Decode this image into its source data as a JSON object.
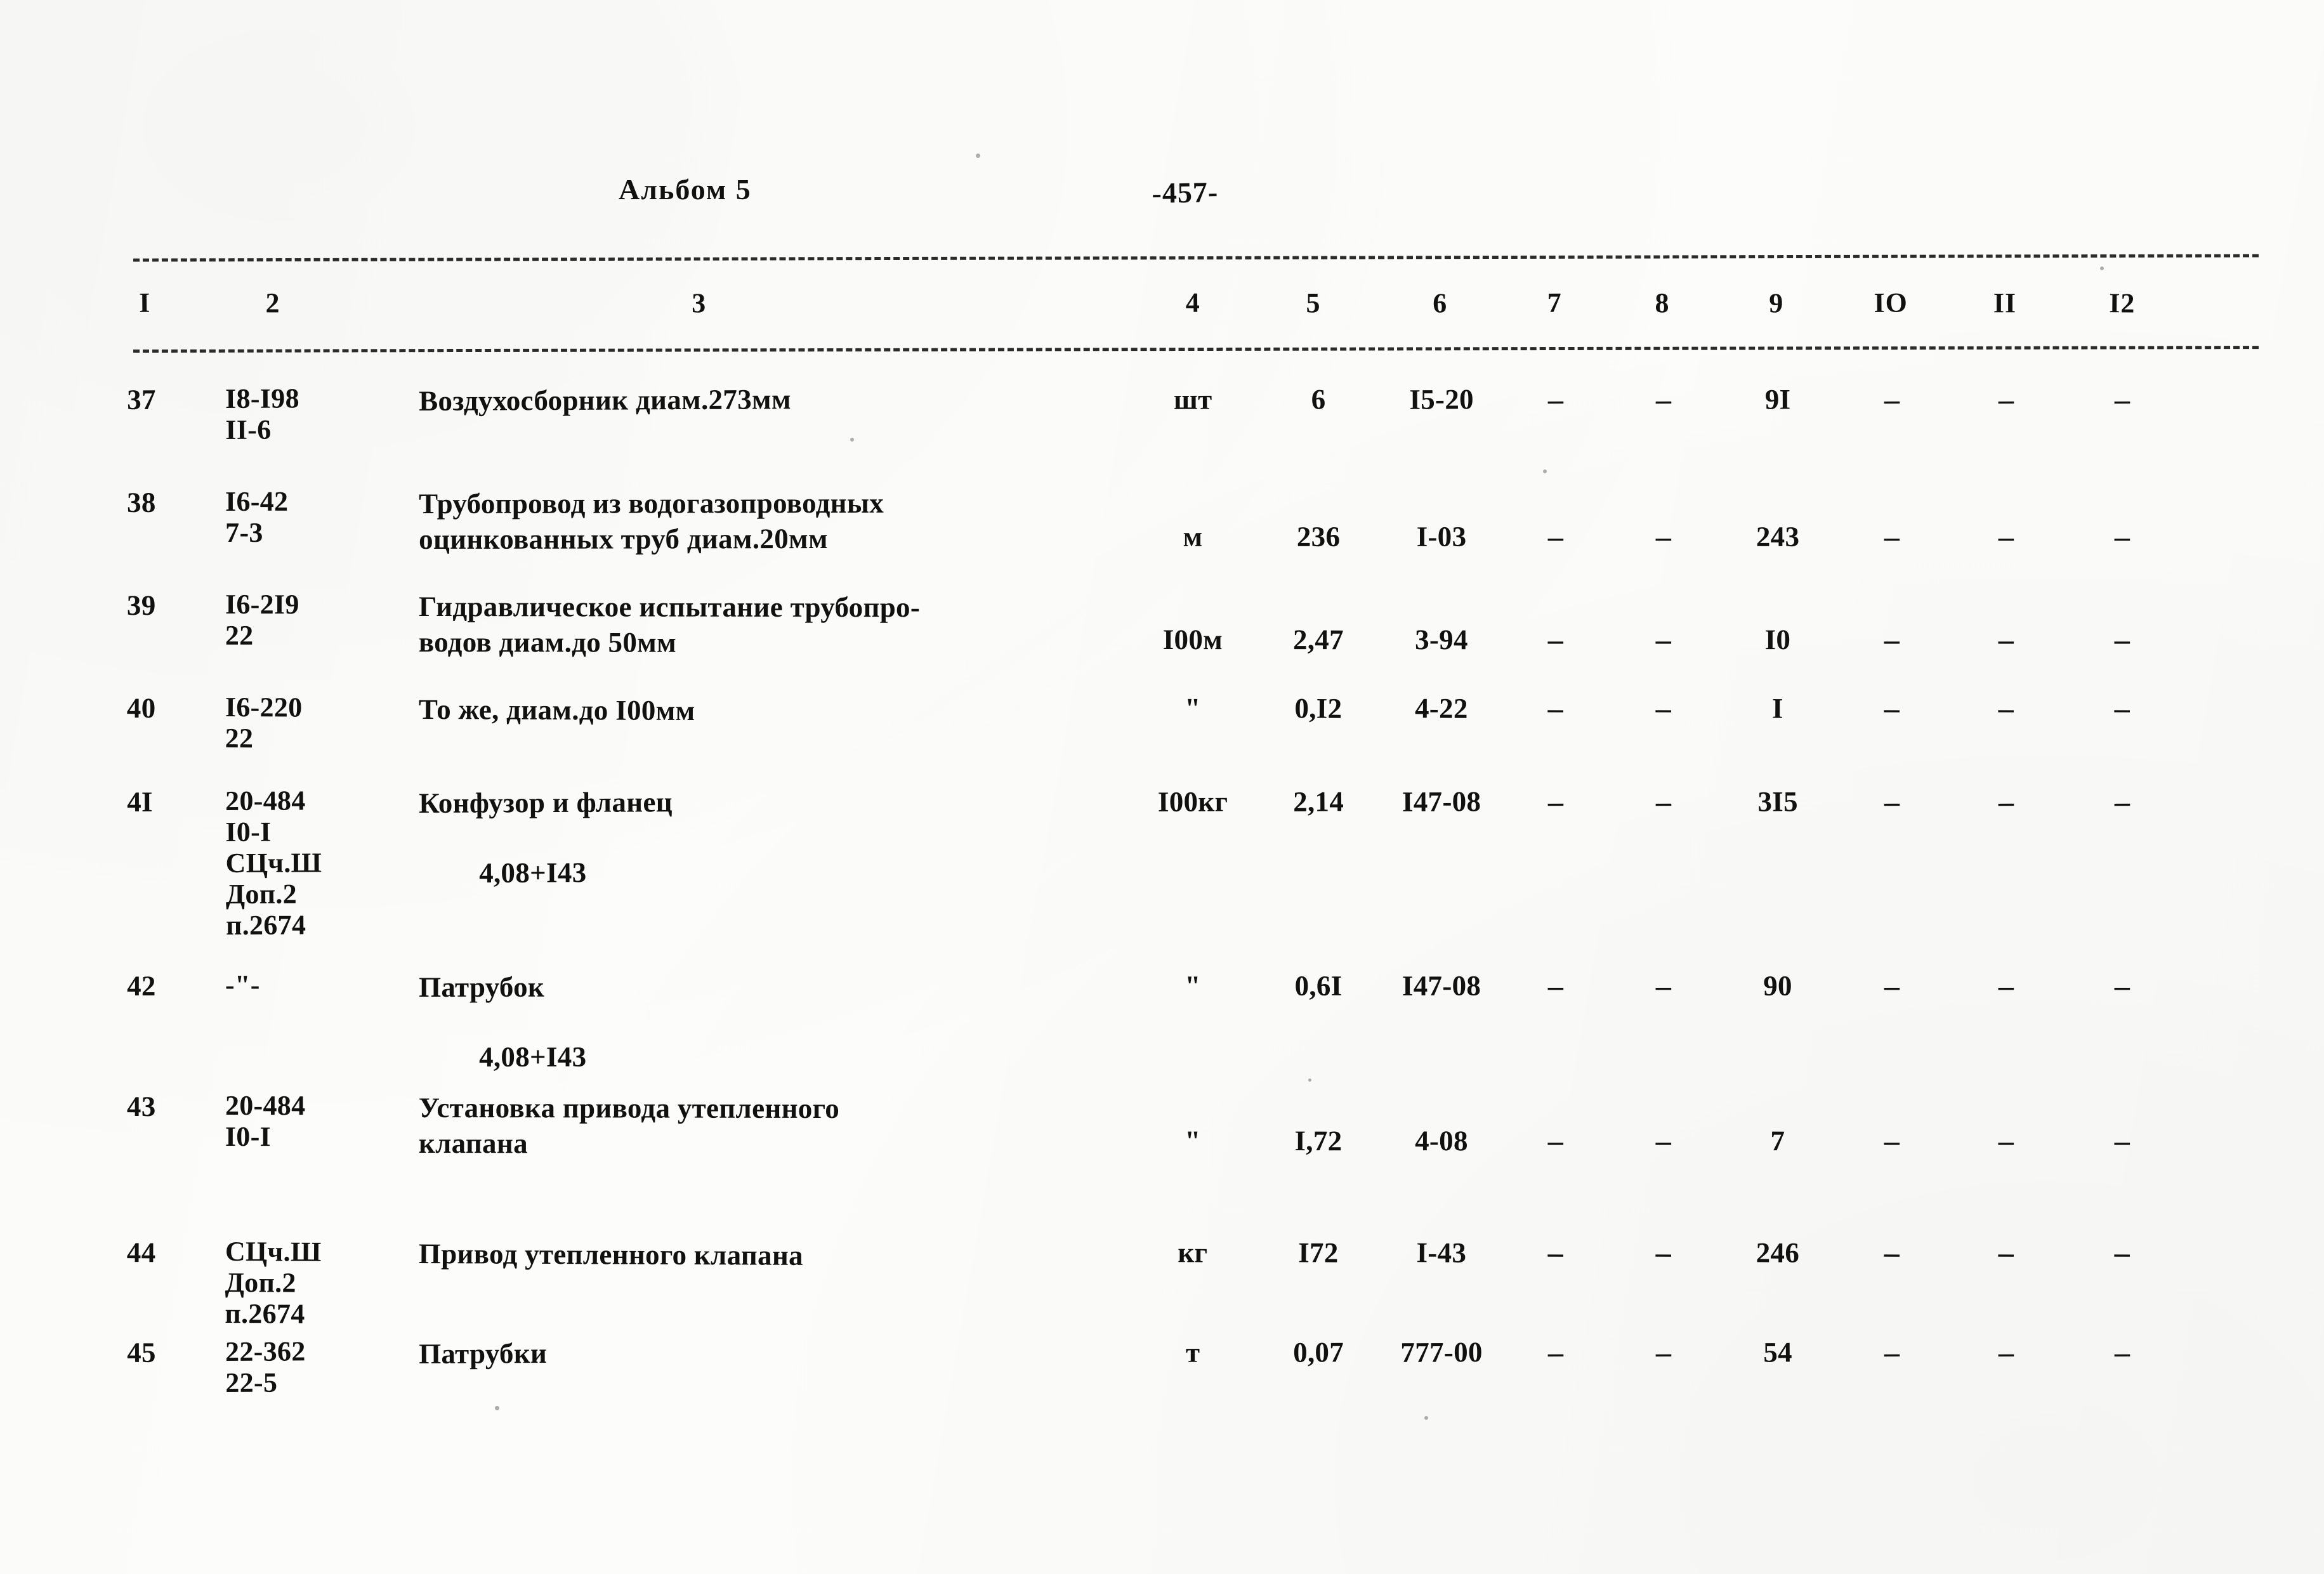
{
  "header": {
    "album_label": "Альбом 5",
    "page_number": "-457-"
  },
  "table": {
    "column_numbers": [
      "I",
      "2",
      "3",
      "4",
      "5",
      "6",
      "7",
      "8",
      "9",
      "IO",
      "II",
      "I2"
    ],
    "rows": [
      {
        "num": "37",
        "code": "I8-I98\nII-6",
        "name": "Воздухосборник диам.273мм",
        "name2": "",
        "unit": "шт",
        "c5": "6",
        "c6": "I5-20",
        "c7": "–",
        "c8": "–",
        "c9": "9I",
        "c10": "–",
        "c11": "–",
        "c12": "–"
      },
      {
        "num": "38",
        "code": "I6-42\n7-3",
        "name": "Трубопровод из водогазопроводных\nоцинкованных труб диам.20мм",
        "name2": "",
        "unit": "м",
        "c5": "236",
        "c6": "I-03",
        "c7": "–",
        "c8": "–",
        "c9": "243",
        "c10": "–",
        "c11": "–",
        "c12": "–"
      },
      {
        "num": "39",
        "code": "I6-2I9\n22",
        "name": "Гидравлическое испытание трубопро-\nводов диам.до 50мм",
        "name2": "",
        "unit": "I00м",
        "c5": "2,47",
        "c6": "3-94",
        "c7": "–",
        "c8": "–",
        "c9": "I0",
        "c10": "–",
        "c11": "–",
        "c12": "–"
      },
      {
        "num": "40",
        "code": "I6-220\n22",
        "name": "То же, диам.до I00мм",
        "name2": "",
        "unit": "\"",
        "c5": "0,I2",
        "c6": "4-22",
        "c7": "–",
        "c8": "–",
        "c9": "I",
        "c10": "–",
        "c11": "–",
        "c12": "–"
      },
      {
        "num": "4I",
        "code": "20-484\nI0-I\nСЦч.Ш\nДоп.2\nп.2674",
        "name": "Конфузор и фланец",
        "name2": "4,08+I43",
        "unit": "I00кг",
        "c5": "2,14",
        "c6": "I47-08",
        "c7": "–",
        "c8": "–",
        "c9": "3I5",
        "c10": "–",
        "c11": "–",
        "c12": "–"
      },
      {
        "num": "42",
        "code": "-\"-",
        "name": "Патрубок",
        "name2": "4,08+I43",
        "unit": "\"",
        "c5": "0,6I",
        "c6": "I47-08",
        "c7": "–",
        "c8": "–",
        "c9": "90",
        "c10": "–",
        "c11": "–",
        "c12": "–"
      },
      {
        "num": "43",
        "code": "20-484\nI0-I",
        "name": "Установка привода утепленного\nклапана",
        "name2": "",
        "unit": "\"",
        "c5": "I,72",
        "c6": "4-08",
        "c7": "–",
        "c8": "–",
        "c9": "7",
        "c10": "–",
        "c11": "–",
        "c12": "–"
      },
      {
        "num": "44",
        "code": "СЦч.Ш\nДоп.2\nп.2674",
        "name": "Привод утепленного клапана",
        "name2": "",
        "unit": "кг",
        "c5": "I72",
        "c6": "I-43",
        "c7": "–",
        "c8": "–",
        "c9": "246",
        "c10": "–",
        "c11": "–",
        "c12": "–"
      },
      {
        "num": "45",
        "code": "22-362\n22-5",
        "name": "Патрубки",
        "name2": "",
        "unit": "т",
        "c5": "0,07",
        "c6": "777-00",
        "c7": "–",
        "c8": "–",
        "c9": "54",
        "c10": "–",
        "c11": "–",
        "c12": "–"
      }
    ]
  }
}
